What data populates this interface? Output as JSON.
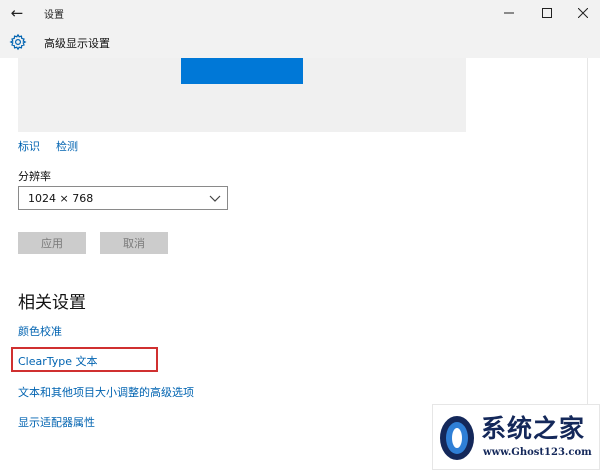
{
  "window": {
    "app_title": "设置",
    "back_icon": "arrow-left-icon",
    "controls": [
      "minimize-icon",
      "maximize-icon",
      "close-icon"
    ]
  },
  "header": {
    "icon": "gear-icon",
    "title": "高级显示设置"
  },
  "display": {
    "identify_label": "标识",
    "detect_label": "检测"
  },
  "resolution": {
    "label": "分辨率",
    "value": "1024 × 768"
  },
  "actions": {
    "apply_label": "应用",
    "cancel_label": "取消"
  },
  "related": {
    "title": "相关设置",
    "links": [
      "颜色校准",
      "ClearType 文本",
      "文本和其他项目大小调整的高级选项",
      "显示适配器属性"
    ]
  },
  "watermark": {
    "name": "系统之家",
    "url": "www.Ghost123.com"
  },
  "colors": {
    "accent": "#0078d7",
    "link": "#0063b1",
    "highlight": "#d03030",
    "header_bg": "#f2f2f2"
  }
}
